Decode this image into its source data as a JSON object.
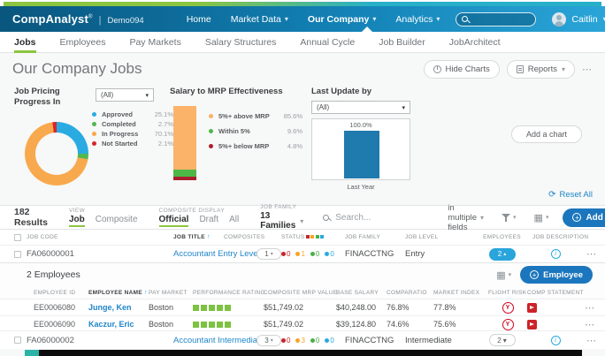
{
  "icons": {
    "caret_down": "▾",
    "caret_up": "▴",
    "sort_asc": "↑",
    "more": "⋯",
    "info": "i",
    "plus": "+",
    "reset": "⟳",
    "divider": "|",
    "grid": "▦"
  },
  "brand": {
    "name": "CompAnalyst",
    "reg": "®",
    "env": "Demo094"
  },
  "top_nav": {
    "items": [
      {
        "label": "Home"
      },
      {
        "label": "Market Data"
      },
      {
        "label": "Our Company"
      },
      {
        "label": "Analytics"
      }
    ],
    "user_name": "Caitlin"
  },
  "tabs": [
    {
      "label": "Jobs"
    },
    {
      "label": "Employees"
    },
    {
      "label": "Pay Markets"
    },
    {
      "label": "Salary Structures"
    },
    {
      "label": "Annual Cycle"
    },
    {
      "label": "Job Builder"
    },
    {
      "label": "JobArchitect"
    }
  ],
  "page": {
    "title": "Our Company Jobs",
    "hide_charts_label": "Hide Charts",
    "reports_label": "Reports",
    "add_chart_label": "Add a chart",
    "reset_all_label": "Reset All"
  },
  "chart_data": [
    {
      "type": "pie",
      "subtype": "donut",
      "title": "Job Pricing Progress In",
      "filter_value": "(All)",
      "legend_position": "right",
      "categories": [
        "Approved",
        "Completed",
        "In Progress",
        "Not Started"
      ],
      "values": [
        25.1,
        2.7,
        70.1,
        2.1
      ],
      "series": [
        {
          "name": "Approved",
          "value": 25.1,
          "display": "25.1%",
          "color": "#29abe2"
        },
        {
          "name": "Completed",
          "value": 2.7,
          "display": "2.7%",
          "color": "#52b74c"
        },
        {
          "name": "In Progress",
          "value": 70.1,
          "display": "70.1%",
          "color": "#f8a94d"
        },
        {
          "name": "Not Started",
          "value": 2.1,
          "display": "2.1%",
          "color": "#d7252c"
        }
      ]
    },
    {
      "type": "bar",
      "subtype": "stacked-single-column",
      "title": "Salary to MRP Effectiveness",
      "categories": [
        "5%+ above MRP",
        "Within 5%",
        "5%+ below MRP"
      ],
      "values": [
        85.6,
        9.6,
        4.8
      ],
      "series": [
        {
          "name": "5%+ above MRP",
          "value": 85.6,
          "display": "85.6%",
          "color": "#fbb369"
        },
        {
          "name": "Within 5%",
          "value": 9.6,
          "display": "9.6%",
          "color": "#4db848"
        },
        {
          "name": "5%+ below MRP",
          "value": 4.8,
          "display": "4.8%",
          "color": "#aa1e2e"
        }
      ]
    },
    {
      "type": "bar",
      "title": "Last Update by",
      "filter_value": "(All)",
      "ylim": [
        0,
        100
      ],
      "categories": [
        "Last Year"
      ],
      "values": [
        100.0
      ],
      "series": [
        {
          "name": "Last Year",
          "value": 100.0,
          "display": "100.0%",
          "color": "#1f7aad"
        }
      ]
    }
  ],
  "results_bar": {
    "count": "182 Results",
    "view_label": "VIEW",
    "view_options": [
      {
        "label": "Job"
      },
      {
        "label": "Composite"
      }
    ],
    "composite_label": "COMPOSITE DISPLAY",
    "composite_options": [
      {
        "label": "Official"
      },
      {
        "label": "Draft"
      },
      {
        "label": "All"
      }
    ],
    "job_family_label": "JOB FAMILY",
    "job_family_value": "13 Families",
    "search_placeholder": "Search...",
    "search_scope": "in multiple fields",
    "add_label": "Add"
  },
  "jobs_table": {
    "columns": [
      "JOB CODE",
      "JOB TITLE",
      "COMPOSITES",
      "STATUS",
      "JOB FAMILY",
      "JOB LEVEL",
      "EMPLOYEES",
      "JOB DESCRIPTION"
    ],
    "status_colors": [
      "#c9252c",
      "#f5a623",
      "#4cae4c",
      "#2aa9e0"
    ],
    "rows": [
      {
        "job_code": "FA06000001",
        "job_title": "Accountant Entry Level",
        "composites": "1",
        "status": [
          "0",
          "1",
          "0",
          "0"
        ],
        "job_family": "FINACCTNG",
        "job_level": "Entry",
        "employees": "2",
        "expanded": true
      },
      {
        "job_code": "FA06000002",
        "job_title": "Accountant Intermediate",
        "composites": "3",
        "status": [
          "0",
          "3",
          "0",
          "0"
        ],
        "job_family": "FINACCTNG",
        "job_level": "Intermediate",
        "employees": "2",
        "expanded": false
      }
    ]
  },
  "employees_panel": {
    "title": "2 Employees",
    "add_label": "Employee",
    "columns": [
      "EMPLOYEE ID",
      "EMPLOYEE NAME",
      "PAY MARKET",
      "PERFORMANCE RATING",
      "COMPOSITE MRP VALUE",
      "BASE SALARY",
      "COMPARATIO",
      "MARKET INDEX",
      "FLIGHT RISK",
      "COMP STATEMENT"
    ],
    "rows": [
      {
        "employee_id": "EE0006080",
        "employee_name": "Junge, Ken",
        "pay_market": "Boston",
        "performance_rating": 5,
        "composite_mrp_value": "$51,749.02",
        "base_salary": "$40,248.00",
        "comparatio": "76.8%",
        "market_index": "77.8%",
        "flight_risk": "Y",
        "comp_statement": "PDF"
      },
      {
        "employee_id": "EE0006090",
        "employee_name": "Kaczur, Eric",
        "pay_market": "Boston",
        "performance_rating": 5,
        "composite_mrp_value": "$51,749.02",
        "base_salary": "$39,124.80",
        "comparatio": "74.6%",
        "market_index": "75.6%",
        "flight_risk": "Y",
        "comp_statement": "PDF"
      }
    ]
  },
  "colors": {
    "header_gradient_start": "#09567e",
    "header_gradient_end": "#25a0d4",
    "accent_green": "#8cc540",
    "accent_cyan": "#27b0c8",
    "primary_button": "#1b76bd",
    "link": "#1f86c9",
    "employees_badge": "#29a5dc"
  }
}
